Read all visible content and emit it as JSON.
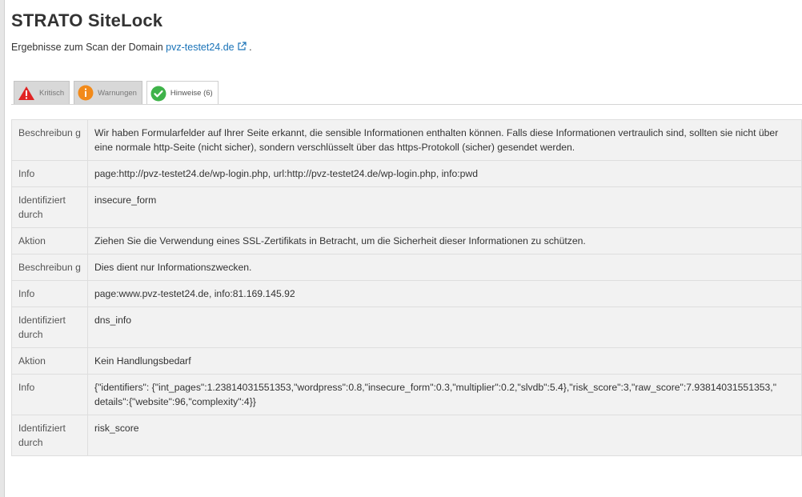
{
  "header": {
    "title": "STRATO SiteLock",
    "subtitle_prefix": "Ergebnisse zum Scan der Domain ",
    "domain_link": "pvz-testet24.de",
    "subtitle_suffix": " ."
  },
  "tabs": [
    {
      "label": "Kritisch",
      "icon": "warning-triangle-icon",
      "color": "#e02424",
      "active": false
    },
    {
      "label": "Warnungen",
      "icon": "info-circle-icon",
      "color": "#f28a1a",
      "active": false
    },
    {
      "label": "Hinweise (6)",
      "icon": "check-circle-icon",
      "color": "#3fb34a",
      "active": true
    }
  ],
  "results": [
    {
      "label": "Beschreibun g",
      "value": "Wir haben Formularfelder auf Ihrer Seite erkannt, die sensible Informationen enthalten können. Falls diese Informationen vertraulich sind, sollten sie nicht über eine normale http-Seite (nicht sicher), sondern verschlüsselt über das https-Protokoll (sicher) gesendet werden."
    },
    {
      "label": "Info",
      "value": "page:http://pvz-testet24.de/wp-login.php, url:http://pvz-testet24.de/wp-login.php, info:pwd"
    },
    {
      "label": "Identifiziert durch",
      "value": "insecure_form"
    },
    {
      "label": "Aktion",
      "value": "Ziehen Sie die Verwendung eines SSL-Zertifikats in Betracht, um die Sicherheit dieser Informationen zu schützen."
    },
    {
      "label": "Beschreibun g",
      "value": "Dies dient nur Informationszwecken."
    },
    {
      "label": "Info",
      "value": "page:www.pvz-testet24.de, info:81.169.145.92"
    },
    {
      "label": "Identifiziert durch",
      "value": "dns_info"
    },
    {
      "label": "Aktion",
      "value": "Kein Handlungsbedarf"
    },
    {
      "label": "Info",
      "value": "{\"identifiers\": {\"int_pages\":1.23814031551353,\"wordpress\":0.8,\"insecure_form\":0.3,\"multiplier\":0.2,\"slvdb\":5.4},\"risk_score\":3,\"raw_score\":7.93814031551353,\" details\":{\"website\":96,\"complexity\":4}}"
    },
    {
      "label": "Identifiziert durch",
      "value": "risk_score"
    }
  ]
}
